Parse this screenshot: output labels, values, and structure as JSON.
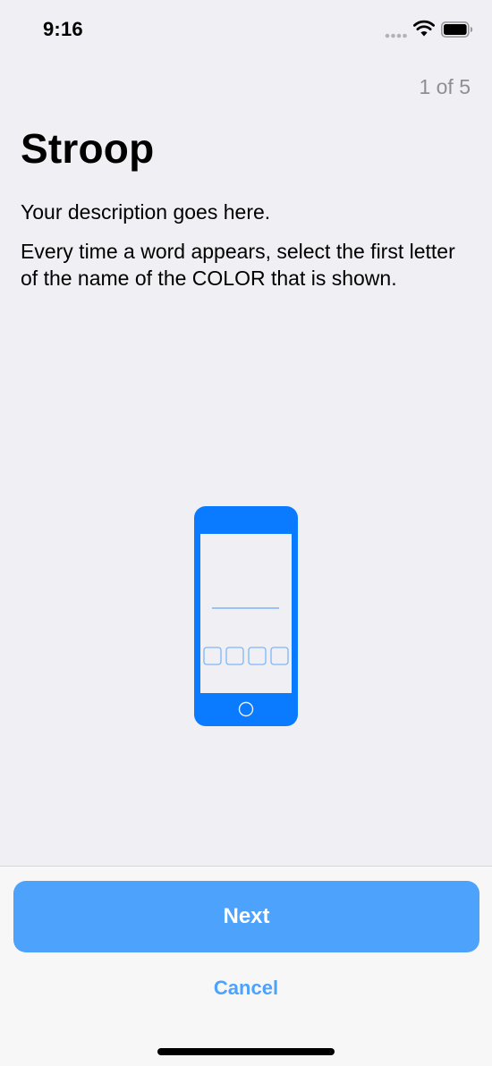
{
  "status_bar": {
    "time": "9:16",
    "icons": [
      "signal-dots-icon",
      "wifi-icon",
      "battery-icon"
    ]
  },
  "step_counter": "1 of 5",
  "title": "Stroop",
  "description": "Your description goes here.",
  "instructions": "Every time a word appears, select the first letter of the name of the COLOR that is shown.",
  "illustration": {
    "icon": "phone-stroop-icon"
  },
  "footer": {
    "next_label": "Next",
    "cancel_label": "Cancel"
  },
  "colors": {
    "accent": "#4da2fc",
    "illustration_blue": "#0a7bff",
    "background": "#efeff4",
    "secondary_text": "#8e8e93"
  }
}
